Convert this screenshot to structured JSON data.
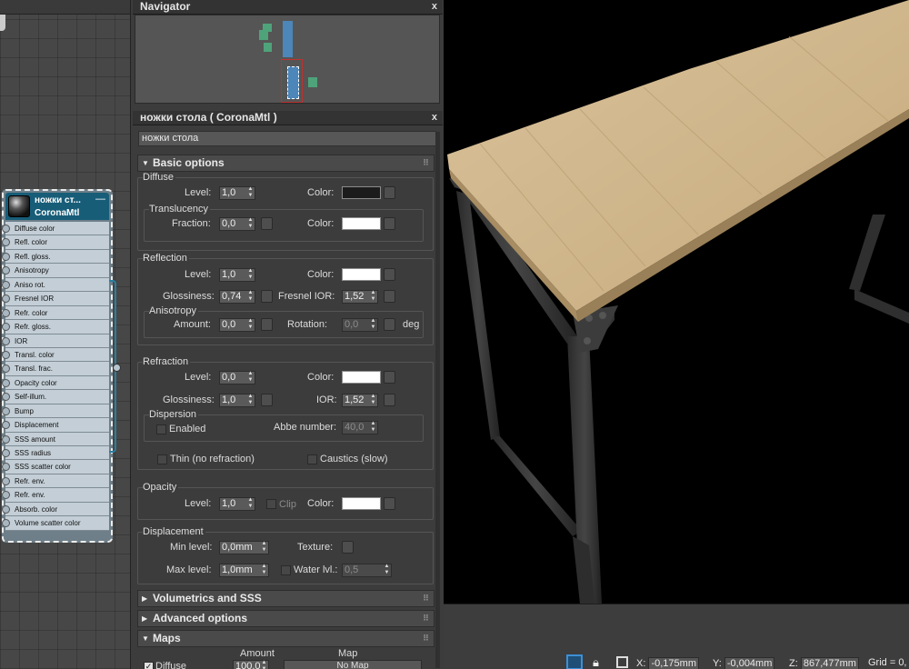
{
  "navigator": {
    "title": "Navigator",
    "close": "x"
  },
  "node": {
    "title": "ножки ст...",
    "type": "CoronaMtl",
    "minimize": "—",
    "slots": [
      "Diffuse color",
      "Refl. color",
      "Refl. gloss.",
      "Anisotropy",
      "Aniso rot.",
      "Fresnel IOR",
      "Refr. color",
      "Refr. gloss.",
      "IOR",
      "Transl. color",
      "Transl. frac.",
      "Opacity color",
      "Self-illum.",
      "Bump",
      "Displacement",
      "SSS amount",
      "SSS radius",
      "SSS scatter color",
      "Refr. env.",
      "Refr. env.",
      "Absorb. color",
      "Volume scatter color"
    ]
  },
  "editor": {
    "title": "ножки стола  ( CoronaMtl )",
    "close": "x",
    "name": "ножки стола",
    "basic": {
      "header": "Basic options",
      "diffuse": {
        "label": "Diffuse",
        "level_label": "Level:",
        "level": "1,0",
        "color_label": "Color:",
        "color": "#1c1c1c"
      },
      "translucency": {
        "label": "Translucency",
        "fraction_label": "Fraction:",
        "fraction": "0,0",
        "color_label": "Color:",
        "color": "#ffffff"
      },
      "reflection": {
        "label": "Reflection",
        "level_label": "Level:",
        "level": "1,0",
        "color_label": "Color:",
        "color": "#ffffff",
        "gloss_label": "Glossiness:",
        "gloss": "0,74",
        "fresnel_label": "Fresnel IOR:",
        "fresnel": "1,52"
      },
      "anisotropy": {
        "label": "Anisotropy",
        "amount_label": "Amount:",
        "amount": "0,0",
        "rotation_label": "Rotation:",
        "rotation": "0,0",
        "deg": "deg"
      },
      "refraction": {
        "label": "Refraction",
        "level_label": "Level:",
        "level": "0,0",
        "color_label": "Color:",
        "color": "#ffffff",
        "gloss_label": "Glossiness:",
        "gloss": "1,0",
        "ior_label": "IOR:",
        "ior": "1,52"
      },
      "dispersion": {
        "label": "Dispersion",
        "enabled_label": "Enabled",
        "abbe_label": "Abbe number:",
        "abbe": "40,0"
      },
      "thin_label": "Thin (no refraction)",
      "caustics_label": "Caustics (slow)",
      "opacity": {
        "label": "Opacity",
        "level_label": "Level:",
        "level": "1,0",
        "clip_label": "Clip",
        "color_label": "Color:",
        "color": "#ffffff"
      },
      "displacement": {
        "label": "Displacement",
        "min_label": "Min level:",
        "min": "0,0mm",
        "texture_label": "Texture:",
        "max_label": "Max level:",
        "max": "1,0mm",
        "water_label": "Water lvl.:",
        "water": "0,5"
      }
    },
    "volumetrics_header": "Volumetrics and SSS",
    "advanced_header": "Advanced options",
    "maps": {
      "header": "Maps",
      "amount_col": "Amount",
      "map_col": "Map",
      "diffuse_label": "Diffuse",
      "diffuse_amount": "100,0",
      "diffuse_map": "No Map"
    }
  },
  "status": {
    "x_label": "X:",
    "x": "-0,175mm",
    "y_label": "Y:",
    "y": "-0,004mm",
    "z_label": "Z:",
    "z": "867,477mm",
    "grid": "Grid = 0,"
  }
}
